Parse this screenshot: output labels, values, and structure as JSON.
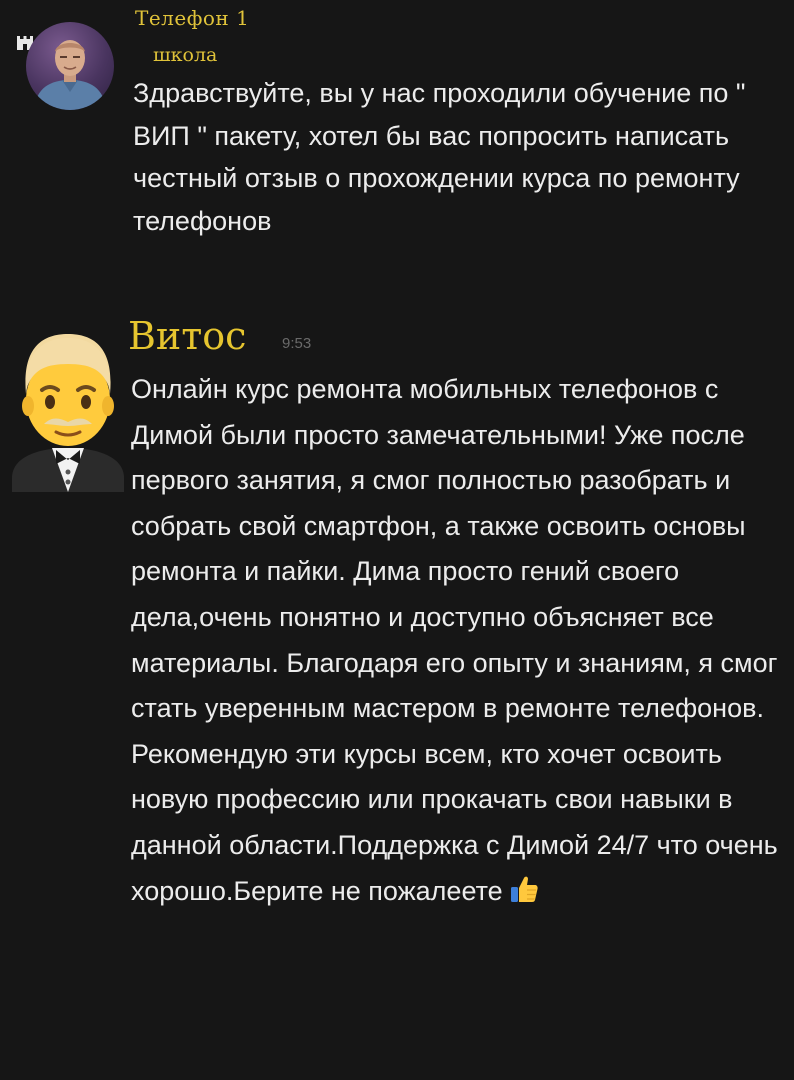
{
  "messages": [
    {
      "sender": "Телефон 1",
      "subtitle": "школа",
      "text": "Здравствуйте, вы у нас проходили обучение по \" ВИП \" пакету, хотел бы вас попросить написать честный отзыв о прохождении курса по ремонту телефонов",
      "avatar": "user-photo-avatar"
    },
    {
      "sender": "Витос",
      "time": "9:53",
      "text": "Онлайн курс ремонта мобильных телефонов с Димой были просто замечательными! Уже после первого занятия, я смог полностью разобрать и собрать свой смартфон, а также освоить основы ремонта и пайки. Дима просто гений своего дела,очень понятно и доступно объясняет все материалы. Благодаря его опыту и знаниям, я смог стать уверенным мастером в ремонте телефонов. Рекомендую эти курсы всем, кто хочет освоить новую профессию или прокачать свои навыки в данной области.Поддержка с Димой 24/7 что очень хорошо.Берите не пожалеете",
      "avatar": "man-in-tuxedo-emoji-avatar",
      "trailing_icon": "thumbs-up-icon"
    }
  ],
  "colors": {
    "background": "#161616",
    "sender_name": "#e6c52f",
    "message_text": "#ececec",
    "timestamp": "#6a6a6a"
  }
}
